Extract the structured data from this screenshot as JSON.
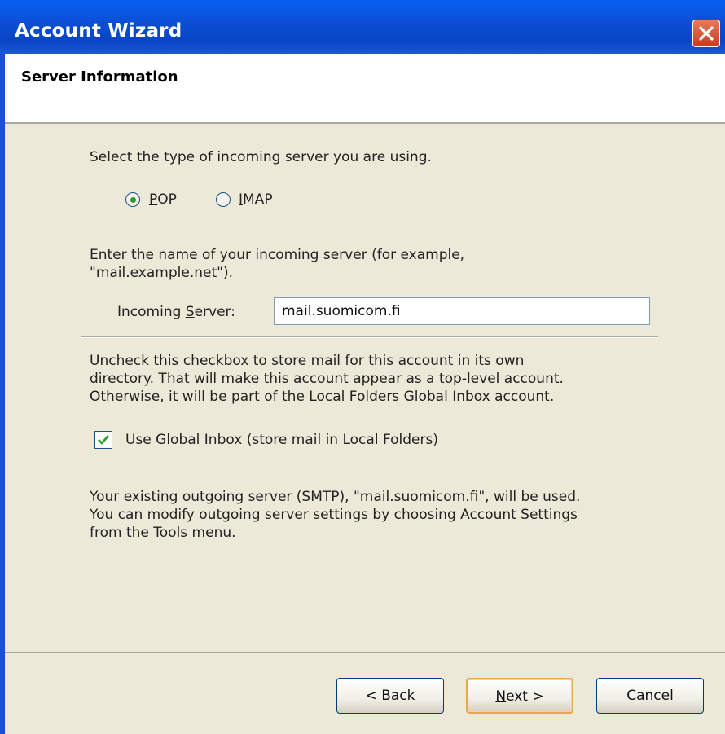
{
  "window": {
    "title": "Account Wizard",
    "close_icon": "close-icon"
  },
  "header": {
    "title": "Server Information"
  },
  "server_type": {
    "prompt": "Select the type of incoming server you are using.",
    "options": [
      {
        "mnemonic": "P",
        "rest": "OP",
        "selected": true
      },
      {
        "mnemonic": "I",
        "rest": "MAP",
        "selected": false
      }
    ]
  },
  "incoming": {
    "prompt_line1": "Enter the name of your incoming server (for example,",
    "prompt_line2": "\"mail.example.net\").",
    "label_pre": "Incoming ",
    "label_mnemonic": "S",
    "label_post": "erver:",
    "value": "mail.suomicom.fi"
  },
  "global_inbox": {
    "desc_line1": "Uncheck this checkbox to store mail for this account in its own",
    "desc_line2": "directory. That will make this account appear as a top-level account.",
    "desc_line3": "Otherwise, it will be part of the Local Folders Global Inbox account.",
    "checkbox_label": "Use Global Inbox (store mail in Local Folders)",
    "checked": true
  },
  "smtp_info": {
    "line1": "Your existing outgoing server (SMTP), \"mail.suomicom.fi\", will be used.",
    "line2": "You can modify outgoing server settings by choosing Account Settings",
    "line3": "from the Tools menu."
  },
  "buttons": {
    "back_pre": "< ",
    "back_mnemonic": "B",
    "back_post": "ack",
    "next_mnemonic": "N",
    "next_post": "ext >",
    "cancel": "Cancel"
  },
  "colors": {
    "titlebar": "#0a55e6",
    "dialog_bg": "#ece9d8",
    "radio_dot": "#21a121",
    "checkmark": "#21a121",
    "default_button_border": "#e5a84d"
  }
}
